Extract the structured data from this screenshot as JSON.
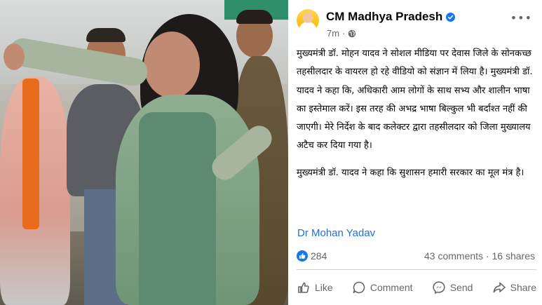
{
  "post": {
    "author": "CM Madhya Pradesh",
    "time": "7m",
    "paragraphs": [
      "मुख्यमंत्री डॉ. मोहन यादव ने सोशल मीडिया पर देवास जिले के सोनकच्छ तहसीलदार के वायरल हो रहे वीडियो को संज्ञान में लिया है। मुख्यमंत्री डॉ. यादव ने कहा कि, अधिकारी आम लोगों के साथ सभ्य और शालीन भाषा का इस्तेमाल करें। इस तरह की अभद्र भाषा बिल्कुल भी बर्दाश्त नहीं की जाएगी। मेरे निर्देश के बाद कलेक्टर द्वारा तहसीलदार को जिला मुख्यालय अटैच कर दिया गया है।",
      "मुख्यमंत्री डॉ. यादव ने कहा कि सुशासन हमारी सरकार का मूल मंत्र है।"
    ],
    "tag": "Dr Mohan Yadav",
    "reactions": "284",
    "comments": "43 comments",
    "shares": "16 shares",
    "separator": "·"
  },
  "actions": {
    "like": "Like",
    "comment": "Comment",
    "send": "Send",
    "share": "Share"
  },
  "icons": {
    "verified": "verified-badge-icon",
    "privacy": "globe-icon",
    "more": "more-icon"
  },
  "colors": {
    "link": "#216fdb",
    "verified": "#1877f2",
    "muted": "#65676b"
  }
}
